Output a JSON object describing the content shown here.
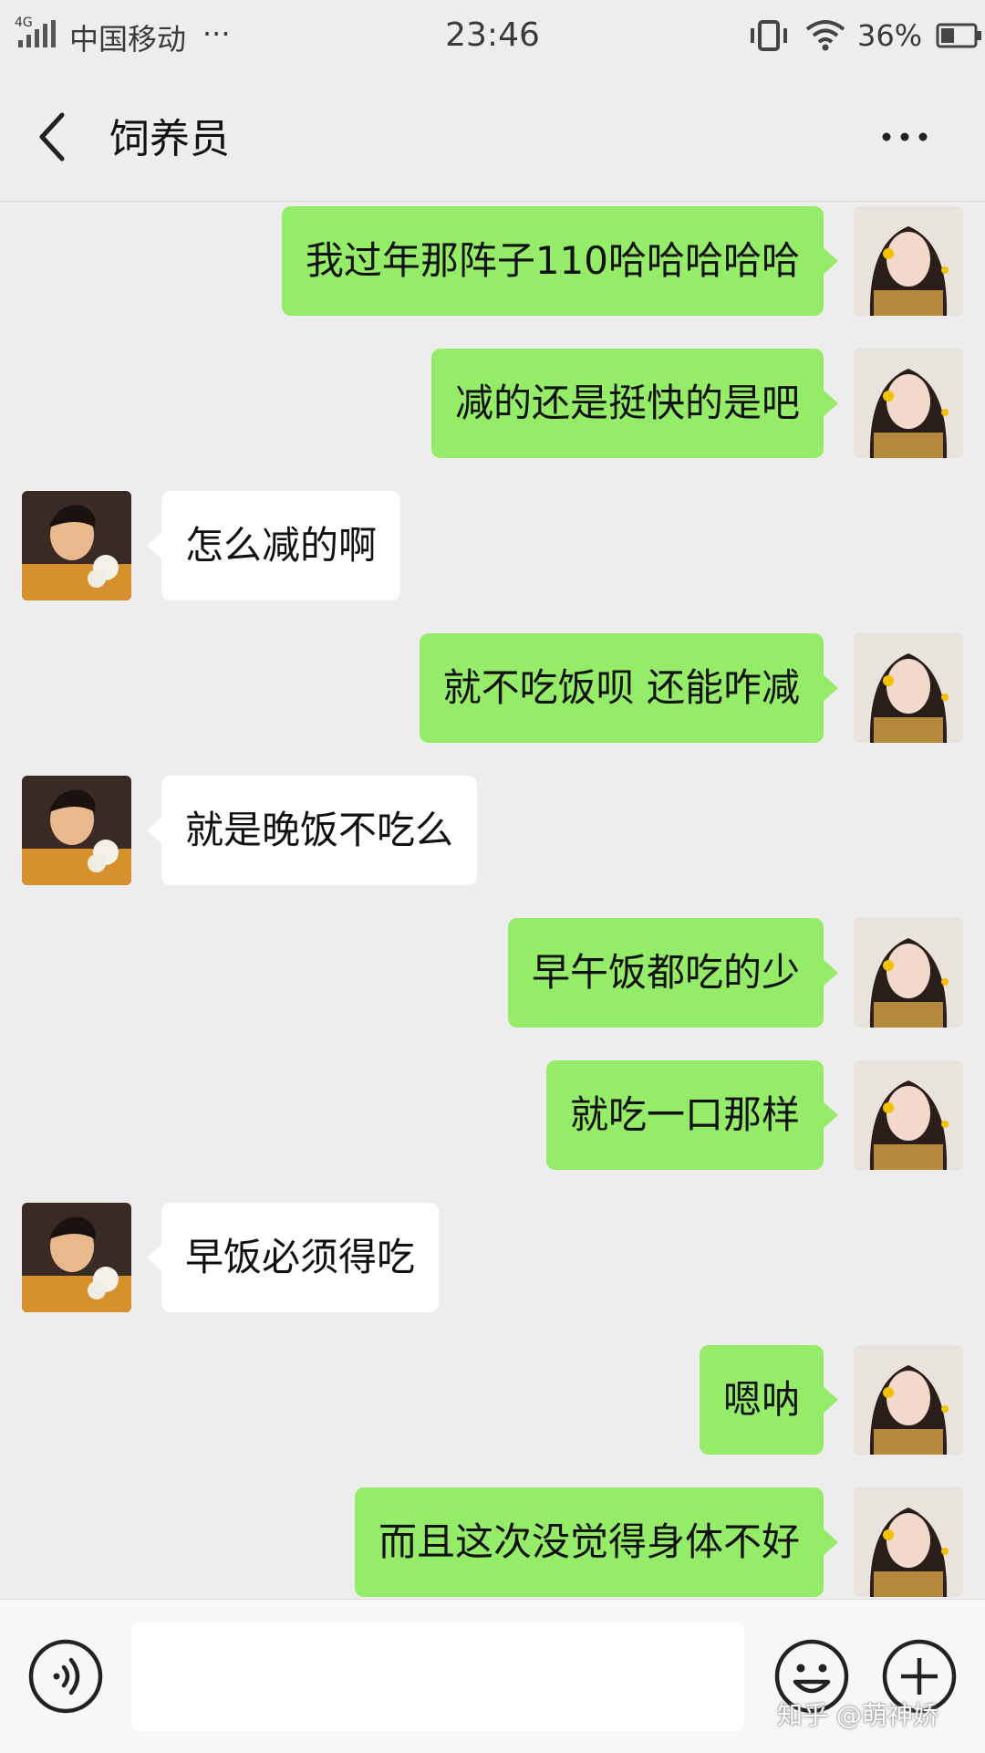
{
  "status_bar": {
    "network": "4G",
    "carrier": "中国移动",
    "more": "···",
    "time": "23:46",
    "battery": "36%"
  },
  "header": {
    "title": "饲养员"
  },
  "messages": [
    {
      "side": "sent",
      "text": "我过年那阵子110哈哈哈哈哈"
    },
    {
      "side": "sent",
      "text": "减的还是挺快的是吧"
    },
    {
      "side": "recv",
      "text": "怎么减的啊"
    },
    {
      "side": "sent",
      "text": "就不吃饭呗 还能咋减"
    },
    {
      "side": "recv",
      "text": "就是晚饭不吃么"
    },
    {
      "side": "sent",
      "text": "早午饭都吃的少"
    },
    {
      "side": "sent",
      "text": "就吃一口那样"
    },
    {
      "side": "recv",
      "text": "早饭必须得吃"
    },
    {
      "side": "sent",
      "text": "嗯呐"
    },
    {
      "side": "sent",
      "text": "而且这次没觉得身体不好"
    }
  ],
  "input_bar": {
    "value": "",
    "placeholder": ""
  },
  "watermark": "知乎 @萌神娇",
  "colors": {
    "background": "#ededed",
    "sent_bubble": "#95ec69",
    "recv_bubble": "#ffffff"
  },
  "icons": [
    "back-icon",
    "more-icon",
    "voice-icon",
    "emoji-icon",
    "plus-icon",
    "wifi-icon",
    "battery-icon",
    "vibrate-icon",
    "signal-icon"
  ]
}
